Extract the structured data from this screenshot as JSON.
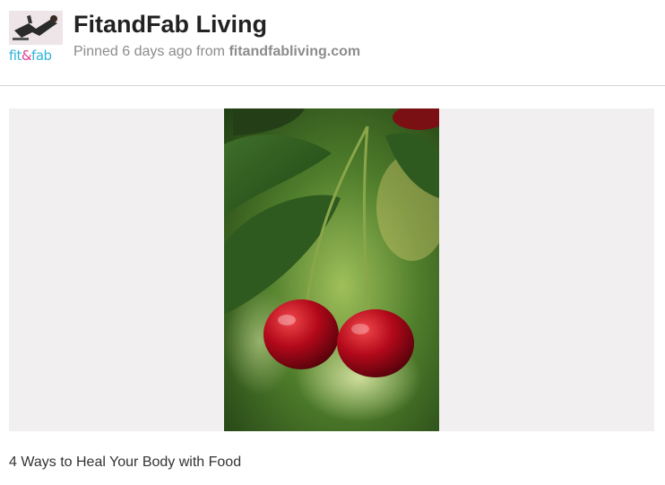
{
  "header": {
    "avatar": {
      "icon": "fitness-photo-logo-icon",
      "logo_text_fit": "fit",
      "logo_text_amp": "&",
      "logo_text_fab": "fab"
    },
    "user_name": "FitandFab Living",
    "pinned_text": "Pinned 6 days ago from ",
    "source": "fitandfabliving.com"
  },
  "pin": {
    "image_subject": "cherries-photo",
    "description": "4 Ways to Heal Your Body with Food"
  },
  "colors": {
    "panel_background": "#f1efef",
    "divider": "#d6d6d6",
    "logo_blue": "#2fb4d8",
    "logo_pink": "#e43a8d",
    "meta_gray": "#8c8c8c"
  }
}
